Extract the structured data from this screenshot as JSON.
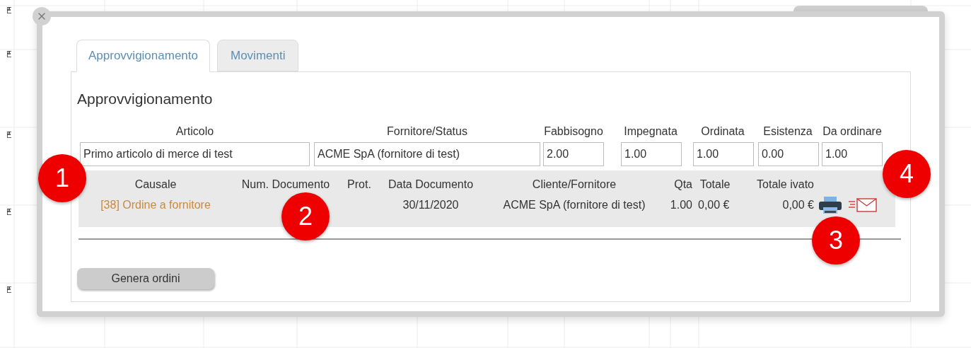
{
  "dialog": {
    "tabs": [
      {
        "label": "Approvvigionamento",
        "selected": true
      },
      {
        "label": "Movimenti",
        "selected": false
      }
    ],
    "section_title": "Approvvigionamento",
    "supply": {
      "columns": [
        "Articolo",
        "Fornitore/Status",
        "Fabbisogno",
        "Impegnata",
        "Ordinata",
        "Esistenza",
        "Da ordinare"
      ],
      "values": [
        "Primo articolo di merce di test",
        "ACME SpA (fornitore di test)",
        "2.00",
        "1.00",
        "1.00",
        "0.00",
        "1.00"
      ]
    },
    "movements": {
      "columns": [
        "Causale",
        "Num. Documento",
        "Prot.",
        "Data Documento",
        "Cliente/Fornitore",
        "Qta",
        "Totale",
        "Totale ivato"
      ],
      "rows": [
        {
          "cells": [
            "[38] Ordine a fornitore",
            null,
            null,
            "30/11/2020",
            "ACME SpA (fornitore di test)",
            "1.00",
            "0,00 €",
            "0,00 €"
          ]
        }
      ]
    },
    "button": "Genera ordini"
  },
  "markers": [
    "1",
    "2",
    "3",
    "4"
  ]
}
